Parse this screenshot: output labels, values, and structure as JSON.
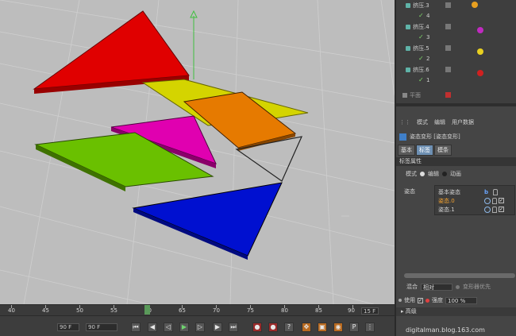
{
  "object_list": {
    "rows": [
      {
        "label": "挤压.3",
        "indent": 1
      },
      {
        "label": "4",
        "indent": 2
      },
      {
        "label": "挤压.4",
        "indent": 1
      },
      {
        "label": "3",
        "indent": 2
      },
      {
        "label": "挤压.5",
        "indent": 1
      },
      {
        "label": "2",
        "indent": 2
      },
      {
        "label": "挤压.6",
        "indent": 1
      },
      {
        "label": "1",
        "indent": 2
      },
      {
        "label": "平面",
        "indent": 0
      }
    ],
    "ball_colors": [
      "#e8a020",
      "#c02ac0",
      "#e8d020",
      "#d02020"
    ]
  },
  "attributes": {
    "menu": [
      "模式",
      "编辑",
      "用户数据"
    ],
    "tag_title": "姿态变形 [姿态变形]",
    "tabs": [
      "基本",
      "标签",
      "模条"
    ],
    "section_header": "标签属性",
    "mode_label": "模式",
    "mode_edit": "编辑",
    "mode_anim": "动画",
    "pose_label": "姿态",
    "poses": [
      {
        "name": "基本姿态",
        "selected": false
      },
      {
        "name": "姿态.0",
        "selected": true
      },
      {
        "name": "姿态.1",
        "selected": false
      }
    ],
    "mix_label": "混合",
    "mix_value": "相对",
    "deform_first": "变形器优先",
    "use_label": "使用",
    "strength_label": "强度",
    "strength_value": "100 %",
    "advanced_label": "高级"
  },
  "timeline": {
    "ticks": [
      "40",
      "45",
      "50",
      "55",
      "60",
      "65",
      "70",
      "75",
      "80",
      "85",
      "90"
    ],
    "current_frame": "15 F",
    "start_frame": "90 F",
    "end_frame": "90 F"
  },
  "watermark": "digitalman.blog.163.com",
  "colors": {
    "red": "#e00000",
    "yellow": "#d4d400",
    "orange": "#e67a00",
    "magenta": "#e000b0",
    "green": "#6ac000",
    "blue": "#0010d0"
  }
}
